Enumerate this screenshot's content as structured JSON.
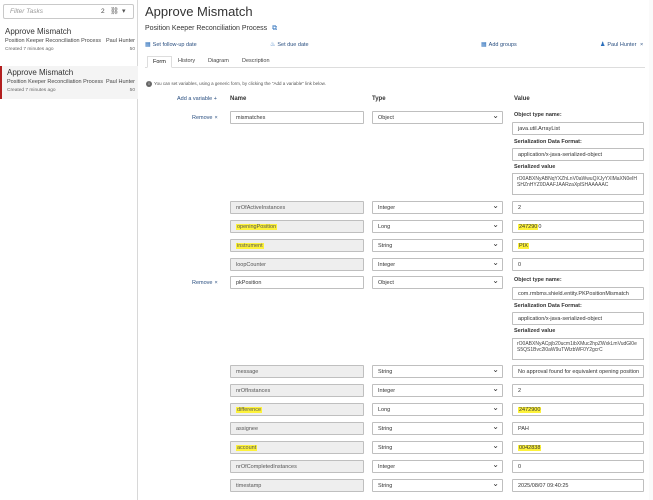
{
  "sidebar": {
    "filter_placeholder": "Filter Tasks",
    "task_count": "2",
    "tasks": [
      {
        "title": "Approve Mismatch",
        "process": "Position Keeper Reconciliation Process",
        "assignee": "Paul Hunter",
        "created": "Created 7 minutes ago",
        "priority": "50"
      },
      {
        "title": "Approve Mismatch",
        "process": "Position Keeper Reconciliation Process",
        "assignee": "Paul Hunter",
        "created": "Created 7 minutes ago",
        "priority": "50"
      }
    ]
  },
  "header": {
    "title": "Approve Mismatch",
    "process": "Position Keeper Reconciliation Process",
    "follow_up": "Set follow-up date",
    "due_date": "Set due date",
    "add_groups": "Add groups",
    "user": "Paul Hunter"
  },
  "tabs": [
    "Form",
    "History",
    "Diagram",
    "Description"
  ],
  "info": "You can set variables, using a generic form, by clicking the \"Add a variable\" link below.",
  "columns": {
    "add": "Add a variable",
    "name": "Name",
    "type": "Type",
    "value": "Value"
  },
  "remove_label": "Remove",
  "labels": {
    "object_type": "Object type name:",
    "serialization": "Serialization Data Format:",
    "serialized": "Serialized value"
  },
  "rows": {
    "mismatches": {
      "name": "mismatches",
      "type": "Object",
      "object_type": "java.util.ArrayList",
      "format": "application/x-java-serialized-object",
      "serialized": "rO0ABXNyABNqYXZhLnV0aWwuQXJyYXlMaXN0eIHSHZnHYZ0DAAFJAARzaXplSHAAAAAC"
    },
    "nrOfActiveInstances": {
      "name": "nrOfActiveInstances",
      "type": "Integer",
      "value": "2"
    },
    "openingPosition": {
      "name": "openingPosition",
      "type": "Long",
      "value_hl": "247290",
      "value_rest": "0"
    },
    "instrument": {
      "name": "instrument",
      "type": "String",
      "value": "PIX"
    },
    "loopCounter": {
      "name": "loopCounter",
      "type": "Integer",
      "value": "0"
    },
    "pkPosition": {
      "name": "pkPosition",
      "type": "Object",
      "object_type": "com.rmbms.shield.entity.PKPositionMismatch",
      "format": "application/x-java-serialized-object",
      "serialized": "rO0ABXNyACpjb20ucm1ibXMuc2hpZWxkLmVudGl0eS5QS1Bvc2l0aW9uTWlzbWF0Y2gcrC"
    },
    "message": {
      "name": "message",
      "type": "String",
      "value": "No approval found for equivalent opening position"
    },
    "nrOfInstances": {
      "name": "nrOfInstances",
      "type": "Integer",
      "value": "2"
    },
    "difference": {
      "name": "difference",
      "type": "Long",
      "value": "2472900"
    },
    "assignee": {
      "name": "assignee",
      "type": "String",
      "value": "PAH"
    },
    "account": {
      "name": "account",
      "type": "String",
      "value": "0042838"
    },
    "nrOfCompletedInstances": {
      "name": "nrOfCompletedInstances",
      "type": "Integer",
      "value": "0"
    },
    "timestamp": {
      "name": "timestamp",
      "type": "String",
      "value": "2025/08/07 09:40:25"
    }
  }
}
